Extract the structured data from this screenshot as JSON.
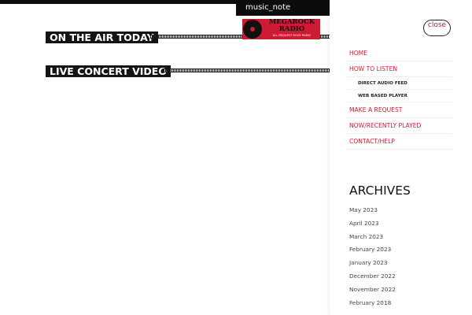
{
  "header": {
    "music_tab": "music_note"
  },
  "main": {
    "heading_on_air": "ON THE AIR TODAY",
    "heading_video": "LIVE CONCERT VIDEO"
  },
  "logo": {
    "line1": "MEGAROCK",
    "line2": "RADIO",
    "tagline": "ALL REQUEST ROCK RADIO"
  },
  "sidebar": {
    "close_label": "close",
    "nav": [
      {
        "label": "HOME"
      },
      {
        "label": "HOW TO LISTEN"
      },
      {
        "label": "DIRECT AUDIO FEED"
      },
      {
        "label": "WEB BASED PLAYER"
      },
      {
        "label": "MAKE A REQUEST"
      },
      {
        "label": "NOW/RECENTLY PLAYED"
      },
      {
        "label": "CONTACT/HELP"
      }
    ],
    "archives_title": "ARCHIVES",
    "archives": [
      "May 2023",
      "April 2023",
      "March 2023",
      "February 2023",
      "January 2023",
      "December 2022",
      "November 2022",
      "February 2018"
    ]
  },
  "colors": {
    "accent": "#cc1b33",
    "dark": "#141414"
  }
}
